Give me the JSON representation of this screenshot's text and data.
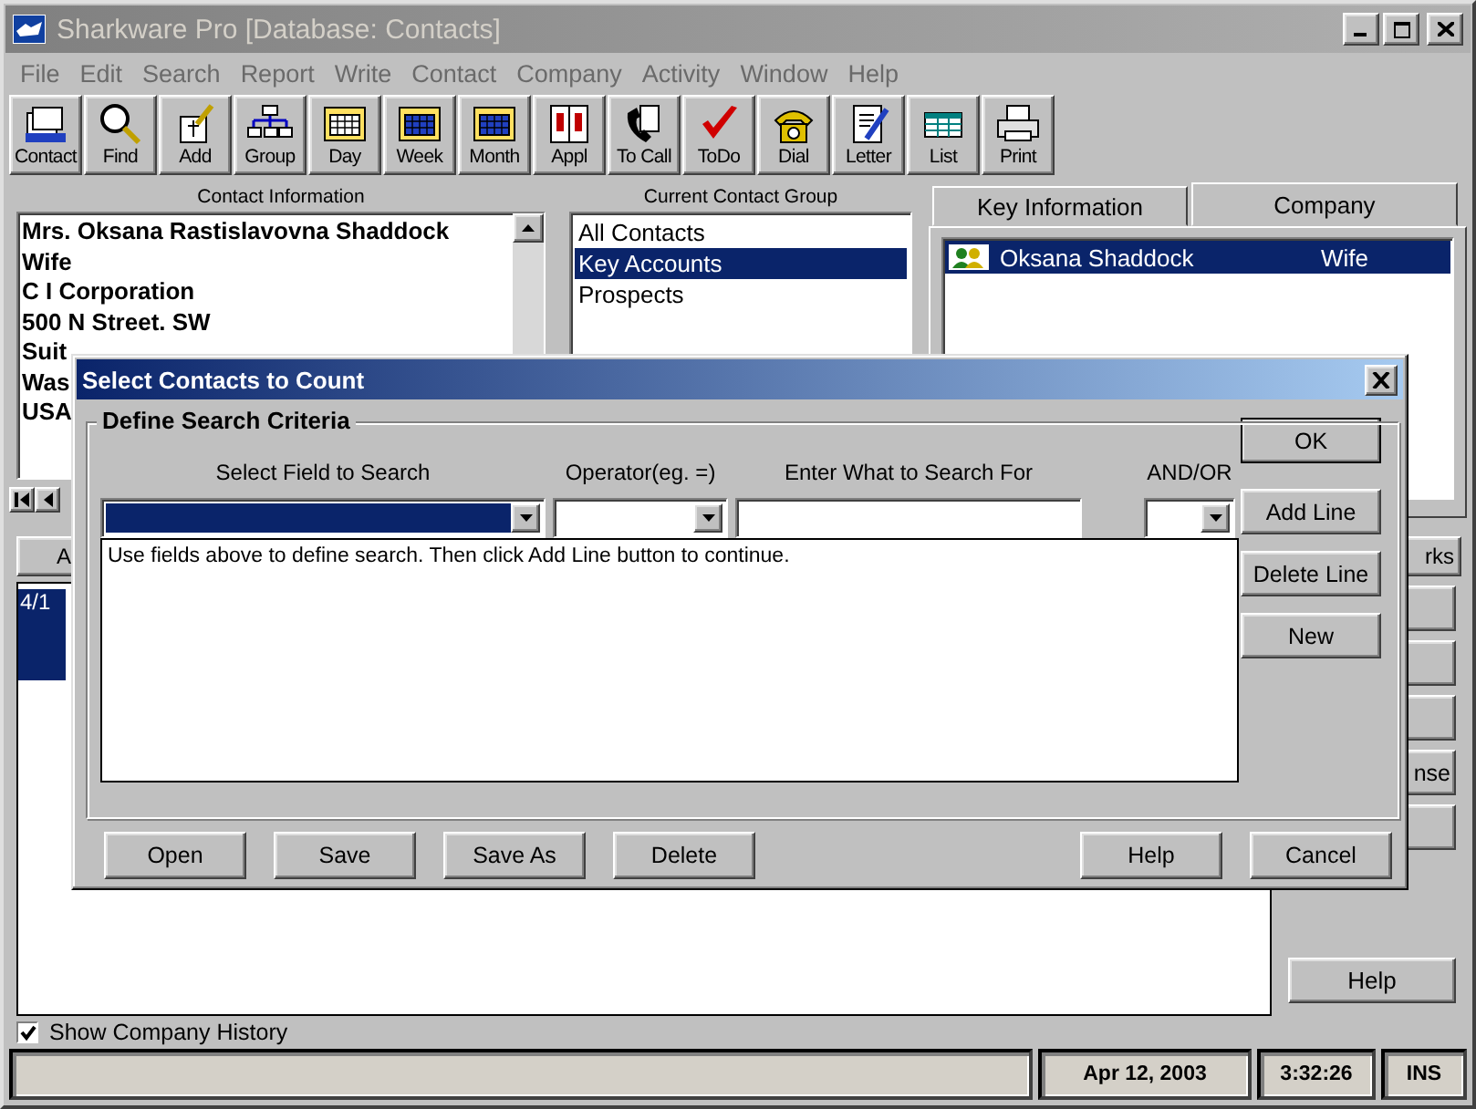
{
  "window": {
    "title": "Sharkware Pro  [Database: Contacts]"
  },
  "menu": [
    "File",
    "Edit",
    "Search",
    "Report",
    "Write",
    "Contact",
    "Company",
    "Activity",
    "Window",
    "Help"
  ],
  "toolbar": [
    {
      "label": "Contact",
      "kind": "cards"
    },
    {
      "label": "Find",
      "kind": "magnifier"
    },
    {
      "label": "Add",
      "kind": "add"
    },
    {
      "label": "Group",
      "kind": "group"
    },
    {
      "label": "Day",
      "kind": "day"
    },
    {
      "label": "Week",
      "kind": "week"
    },
    {
      "label": "Month",
      "kind": "month"
    },
    {
      "label": "Appl",
      "kind": "appt"
    },
    {
      "label": "To Call",
      "kind": "phone"
    },
    {
      "label": "ToDo",
      "kind": "check"
    },
    {
      "label": "Dial",
      "kind": "dial"
    },
    {
      "label": "Letter",
      "kind": "letter"
    },
    {
      "label": "List",
      "kind": "list"
    },
    {
      "label": "Print",
      "kind": "printer"
    }
  ],
  "contact_info": {
    "title": "Contact Information",
    "lines": [
      "Mrs. Oksana Rastislavovna Shaddock",
      "Wife",
      "C I Corporation",
      "500 N Street. SW",
      "Suit",
      "Was",
      "USA"
    ]
  },
  "contact_group": {
    "title": "Current Contact Group",
    "items": [
      {
        "label": "All Contacts",
        "selected": false
      },
      {
        "label": "Key Accounts",
        "selected": true
      },
      {
        "label": "Prospects",
        "selected": false
      }
    ]
  },
  "detail_tabs": [
    {
      "label": "Key Information",
      "selected": false
    },
    {
      "label": "Company",
      "selected": true
    }
  ],
  "company_list": [
    {
      "name": "Oksana Shaddock",
      "relation": "Wife",
      "selected": true
    }
  ],
  "history_tabs": [
    "A",
    "rks"
  ],
  "history_rows": [
    {
      "text": "4/1",
      "selected": true
    }
  ],
  "side_buttons": [
    {
      "kind": "blank"
    },
    {
      "kind": "blank"
    },
    {
      "kind": "blank"
    },
    {
      "kind": "label",
      "label": "nse"
    },
    {
      "kind": "blank"
    }
  ],
  "help_button": "Help",
  "show_company_history": {
    "label": "Show Company History",
    "checked": true
  },
  "status_bar": {
    "date": "Apr 12, 2003",
    "time": "3:32:26",
    "mode": "INS"
  },
  "dialog": {
    "title": "Select Contacts to Count",
    "group_title": "Define Search Criteria",
    "columns": [
      "Select Field to Search",
      "Operator(eg. =)",
      "Enter What to Search For",
      "AND/OR"
    ],
    "hint": "Use fields above to define search. Then click Add Line button to continue.",
    "side_buttons": [
      "OK",
      "Add Line",
      "Delete Line",
      "New"
    ],
    "bottom_left_buttons": [
      "Open",
      "Save",
      "Save As",
      "Delete"
    ],
    "bottom_right_buttons": [
      "Help",
      "Cancel"
    ]
  }
}
